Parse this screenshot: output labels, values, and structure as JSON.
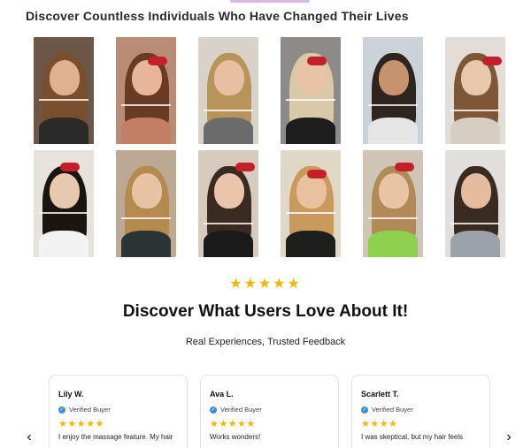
{
  "gallery": {
    "title": "Discover Countless Individuals Who Have Changed Their Lives",
    "row1": [
      {
        "bg": "#6b5648",
        "hair": "#7a4f2e",
        "shirt": "#2a2a2a",
        "skin": "#e0b090"
      },
      {
        "bg": "#b98c76",
        "hair": "#6a3b24",
        "shirt": "#c47e66",
        "skin": "#e8b49a"
      },
      {
        "bg": "#d8d2c8",
        "hair": "#b8935a",
        "shirt": "#6b6b6b",
        "skin": "#e6c0a0"
      },
      {
        "bg": "#8e8a87",
        "hair": "#d9c9a8",
        "shirt": "#1e1e1e",
        "skin": "#e8c3a8"
      },
      {
        "bg": "#cbd3d9",
        "hair": "#2e2420",
        "shirt": "#e5e5e5",
        "skin": "#c7936f"
      },
      {
        "bg": "#e2ddd6",
        "hair": "#7e5738",
        "shirt": "#d6cdc3",
        "skin": "#e9c7ad"
      }
    ],
    "row2": [
      {
        "bg": "#e7e3dc",
        "hair": "#1b1512",
        "shirt": "#f2f2f2",
        "skin": "#e8c9b0"
      },
      {
        "bg": "#bda893",
        "hair": "#b48a4e",
        "shirt": "#2d3436",
        "skin": "#e7c2a3"
      },
      {
        "bg": "#d7cbc0",
        "hair": "#3a2a22",
        "shirt": "#1a1a1a",
        "skin": "#ebc4ac"
      },
      {
        "bg": "#e1d7c6",
        "hair": "#c99a5c",
        "shirt": "#1e1e1e",
        "skin": "#e8c19f"
      },
      {
        "bg": "#cfc5b6",
        "hair": "#b18a58",
        "shirt": "#8fd14f",
        "skin": "#e8c4a4"
      },
      {
        "bg": "#e2dede",
        "hair": "#3b2a22",
        "shirt": "#9ca3a8",
        "skin": "#e6bca0"
      }
    ]
  },
  "rating_stars": "★★★★★",
  "reviews_section": {
    "title": "Discover What Users Love About It!",
    "subtitle": "Real Experiences, Trusted Feedback",
    "prev_arrow": "‹",
    "next_arrow": "›",
    "cards": [
      {
        "name": "Lily W.",
        "verified": "Verified Buyer",
        "stars": "★★★★★",
        "text": "I enjoy the massage feature. My hair"
      },
      {
        "name": "Ava L.",
        "verified": "Verified Buyer",
        "stars": "★★★★★",
        "text": "Works wonders!"
      },
      {
        "name": "Scarlett T.",
        "verified": "Verified Buyer",
        "stars": "★★★★",
        "text": "I was skeptical, but my hair feels"
      }
    ]
  },
  "colors": {
    "star": "#f2b705",
    "verified_check": "#3b8fd9",
    "device": "#c51f2a"
  }
}
